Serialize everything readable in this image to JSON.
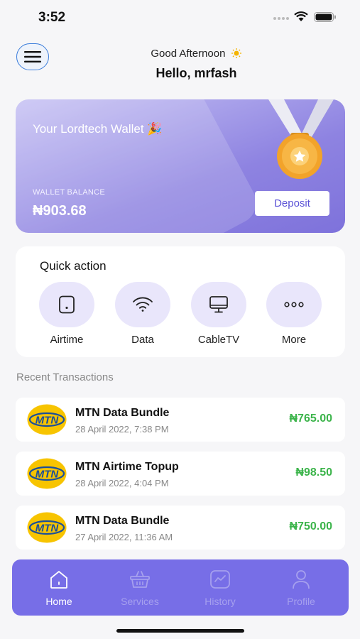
{
  "status_bar": {
    "time": "3:52"
  },
  "header": {
    "greeting": "Good Afternoon",
    "hello": "Hello, mrfash"
  },
  "wallet": {
    "title": "Your Lordtech Wallet 🎉",
    "balance_label": "WALLET BALANCE",
    "balance": "₦903.68",
    "deposit_label": "Deposit"
  },
  "quick_action": {
    "title": "Quick action",
    "items": [
      {
        "label": "Airtime",
        "icon": "phone-icon"
      },
      {
        "label": "Data",
        "icon": "wifi-icon"
      },
      {
        "label": "CableTV",
        "icon": "monitor-icon"
      },
      {
        "label": "More",
        "icon": "more-dots-icon"
      }
    ]
  },
  "recent": {
    "title": "Recent Transactions",
    "transactions": [
      {
        "name": "MTN Data Bundle",
        "date": "28 April 2022, 7:38 PM",
        "amount": "₦765.00",
        "logo_text": "MTN"
      },
      {
        "name": "MTN Airtime Topup",
        "date": "28 April 2022, 4:04 PM",
        "amount": "₦98.50",
        "logo_text": "MTN"
      },
      {
        "name": "MTN Data Bundle",
        "date": "27 April 2022, 11:36 AM",
        "amount": "₦750.00",
        "logo_text": "MTN"
      }
    ]
  },
  "nav": {
    "items": [
      {
        "label": "Home",
        "icon": "home-icon",
        "active": true
      },
      {
        "label": "Services",
        "icon": "basket-icon",
        "active": false
      },
      {
        "label": "History",
        "icon": "chart-icon",
        "active": false
      },
      {
        "label": "Profile",
        "icon": "user-icon",
        "active": false
      }
    ]
  },
  "colors": {
    "accent": "#776ee7",
    "amount_green": "#3cb44b",
    "mtn_yellow": "#f7c400",
    "mtn_blue": "#1b4f9a"
  }
}
